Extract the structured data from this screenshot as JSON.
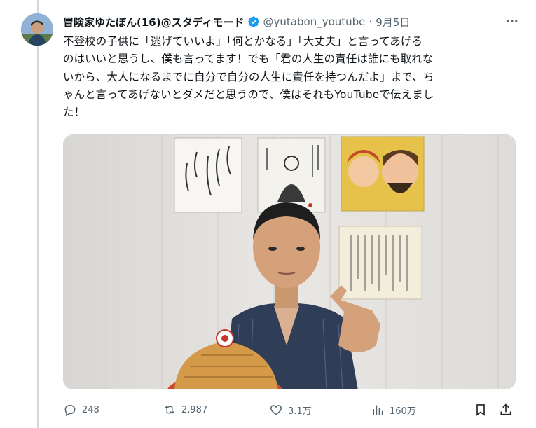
{
  "tweet": {
    "display_name": "冒険家ゆたぼん(16)@スタディモード",
    "handle": "@yutabon_youtube",
    "separator": "·",
    "date": "9月5日",
    "text_lines": [
      "不登校の子供に「逃げていいよ」「何とかなる」「大丈夫」と言ってあげる",
      "のはいいと思うし、僕も言ってます！でも「君の人生の責任は誰にも取れな",
      "いから、大人になるまでに自分で自分の人生に責任を持つんだよ」まで、ち",
      "ゃんと言ってあげないとダメだと思うので、僕はそれもYouTubeで伝えまし",
      "た！"
    ],
    "verified": true,
    "accent_color": "#1d9bf0"
  },
  "actions": {
    "reply": {
      "icon": "reply-icon",
      "count": "248"
    },
    "retweet": {
      "icon": "retweet-icon",
      "count": "2,987"
    },
    "like": {
      "icon": "heart-icon",
      "count": "3.1万"
    },
    "views": {
      "icon": "views-icon",
      "count": "160万"
    },
    "bookmark": {
      "icon": "bookmark-icon"
    },
    "share": {
      "icon": "share-icon"
    }
  },
  "media": {
    "description_icon": "photo"
  }
}
